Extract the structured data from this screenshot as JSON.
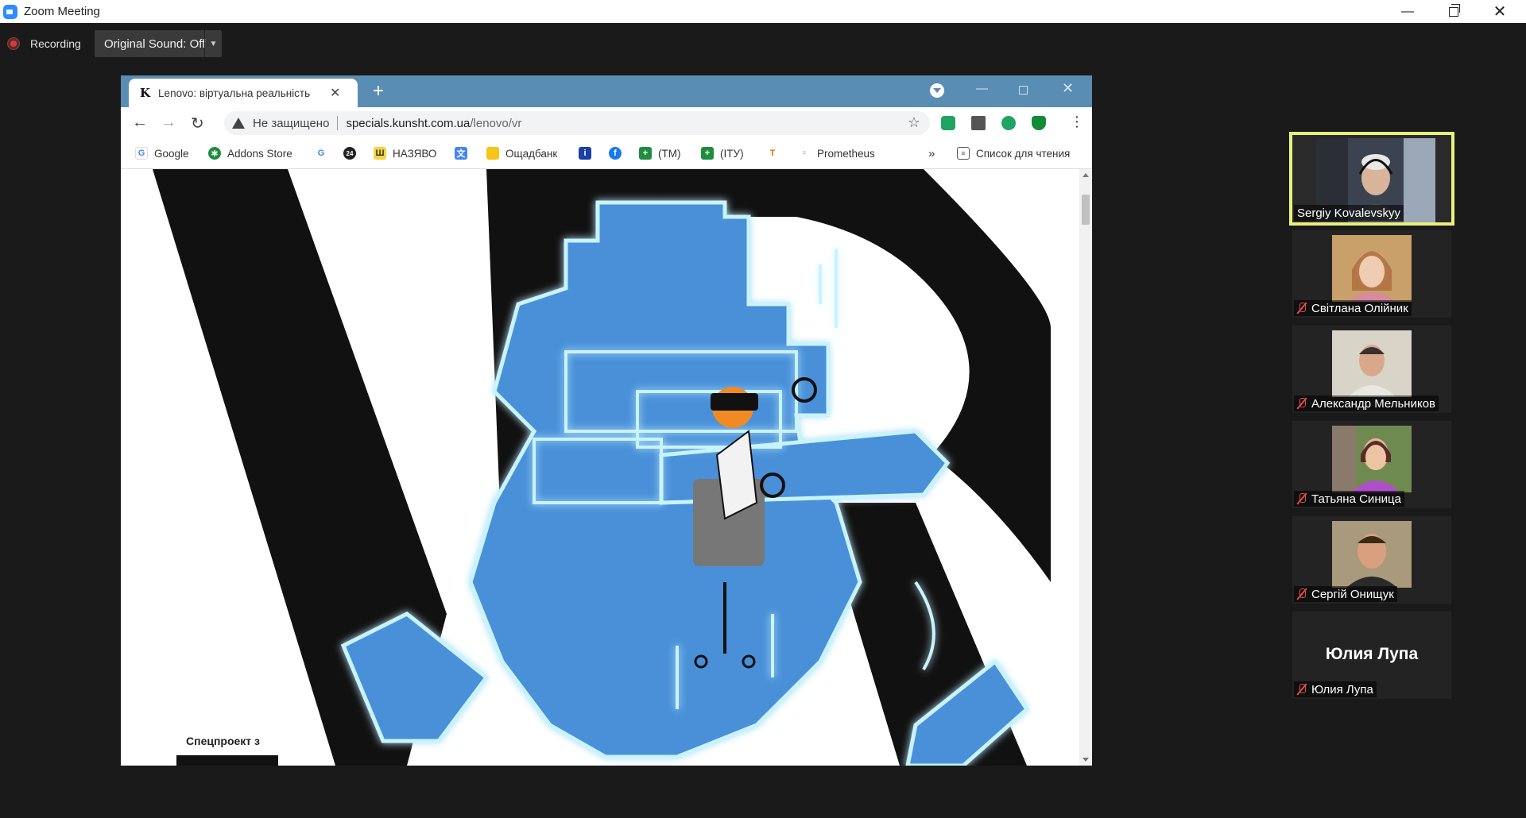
{
  "window": {
    "title": "Zoom Meeting"
  },
  "recording": {
    "label": "Recording"
  },
  "sound": {
    "label": "Original Sound: Off"
  },
  "browser": {
    "tab_title": "Lenovo: віртуальна реальність",
    "security_text": "Не защищено",
    "url_host": "specials.kunsht.com.ua",
    "url_path": "/lenovo/vr",
    "bookmarks": [
      "Google",
      "Addons Store",
      "НАЗЯВО",
      "Ощадбанк",
      "(ТМ)",
      "(ІТУ)",
      "Prometheus"
    ],
    "reading_list": "Список для чтения",
    "page_label": "Спецпроект з"
  },
  "participants": [
    {
      "name": "Sergiy Kovalevskyy"
    },
    {
      "name": "Світлана Олійник"
    },
    {
      "name": "Александр Мельников"
    },
    {
      "name": "Татьяна Синица"
    },
    {
      "name": "Сергій Онищук"
    },
    {
      "name": "Юлия Лупа",
      "display": "Юлия Лупа"
    }
  ],
  "colors": {
    "active_speaker_border": "#e8f27a",
    "muted_mic": "#e34b4b",
    "tab_strip": "#5a8db3",
    "robot_blue": "#4a90d9",
    "glow": "#bff0ff"
  }
}
